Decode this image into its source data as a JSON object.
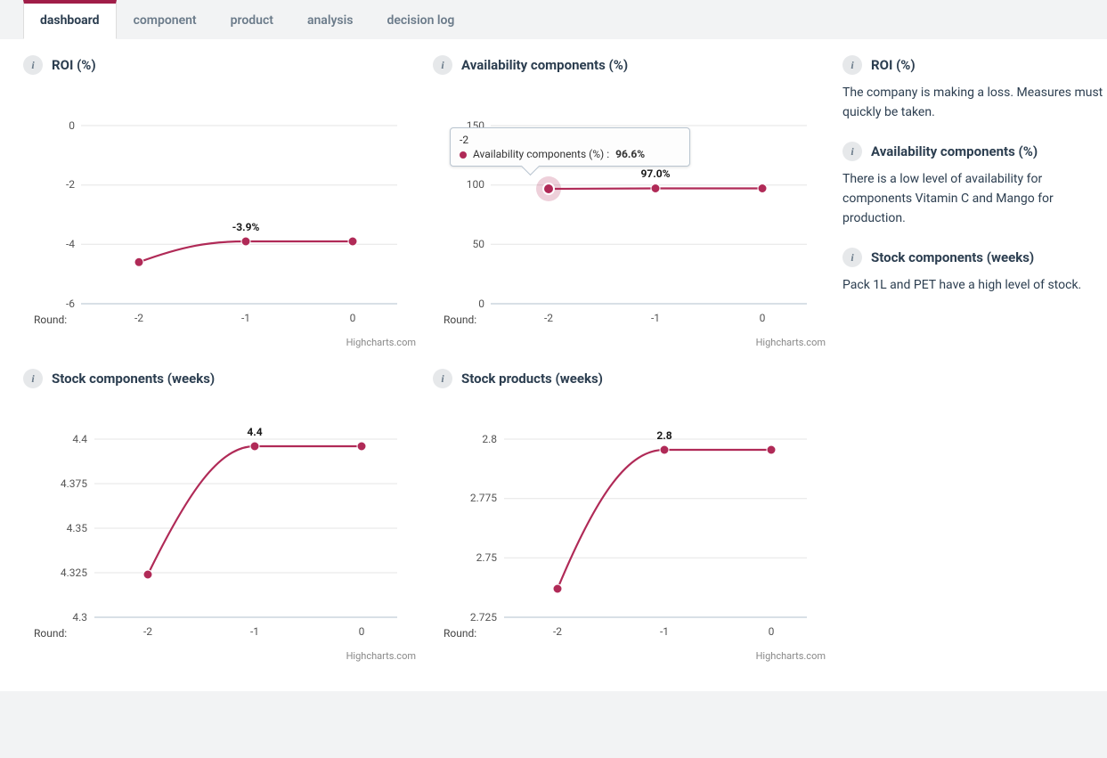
{
  "tabs": {
    "dashboard": "dashboard",
    "component": "component",
    "product": "product",
    "analysis": "analysis",
    "decision_log": "decision log"
  },
  "charts": {
    "roi": {
      "title": "ROI (%)",
      "xtitle": "Round:",
      "credit": "Highcharts.com",
      "ticks_y": [
        "0",
        "-2",
        "-4",
        "-6"
      ],
      "ticks_x": [
        "-2",
        "-1",
        "0"
      ],
      "datalabel": "-3.9%"
    },
    "availability": {
      "title": "Availability components (%)",
      "xtitle": "Round:",
      "credit": "Highcharts.com",
      "ticks_y": [
        "150",
        "100",
        "50",
        "0"
      ],
      "ticks_x": [
        "-2",
        "-1",
        "0"
      ],
      "datalabel": "97.0%",
      "tooltip_header": "-2",
      "tooltip_series": "Availability components (%) :",
      "tooltip_value": "96.6%"
    },
    "stock_components": {
      "title": "Stock components (weeks)",
      "xtitle": "Round:",
      "credit": "Highcharts.com",
      "ticks_y": [
        "4.4",
        "4.375",
        "4.35",
        "4.325",
        "4.3"
      ],
      "ticks_x": [
        "-2",
        "-1",
        "0"
      ],
      "datalabel": "4.4"
    },
    "stock_products": {
      "title": "Stock products (weeks)",
      "xtitle": "Round:",
      "credit": "Highcharts.com",
      "ticks_y": [
        "2.8",
        "2.775",
        "2.75",
        "2.725"
      ],
      "ticks_x": [
        "-2",
        "-1",
        "0"
      ],
      "datalabel": "2.8"
    }
  },
  "sidebar": {
    "roi": {
      "title": "ROI (%)",
      "text": "The company is making a loss. Measures must quickly be taken."
    },
    "availability": {
      "title": "Availability components (%)",
      "text": "There is a low level of availability for components Vitamin C and Mango for production."
    },
    "stock": {
      "title": "Stock components (weeks)",
      "text": "Pack 1L and PET have a high level of stock."
    }
  },
  "colors": {
    "series": "#b02a57",
    "grid": "#e5e5e5",
    "axis": "#ccd6dd"
  },
  "chart_data": [
    {
      "type": "line",
      "title": "ROI (%)",
      "xlabel": "Round:",
      "ylabel": "",
      "categories": [
        "-2",
        "-1",
        "0"
      ],
      "values": [
        -4.6,
        -3.9,
        -3.9
      ],
      "ylim": [
        -6,
        0
      ],
      "data_label": "-3.9%"
    },
    {
      "type": "line",
      "title": "Availability components (%)",
      "xlabel": "Round:",
      "ylabel": "",
      "categories": [
        "-2",
        "-1",
        "0"
      ],
      "values": [
        96.6,
        97.0,
        97.0
      ],
      "ylim": [
        0,
        150
      ],
      "data_label": "97.0%",
      "highlighted_point": {
        "x": "-2",
        "value": 96.6
      }
    },
    {
      "type": "line",
      "title": "Stock components (weeks)",
      "xlabel": "Round:",
      "ylabel": "",
      "categories": [
        "-2",
        "-1",
        "0"
      ],
      "values": [
        4.324,
        4.4,
        4.4
      ],
      "ylim": [
        4.3,
        4.4
      ],
      "data_label": "4.4"
    },
    {
      "type": "line",
      "title": "Stock products (weeks)",
      "xlabel": "Round:",
      "ylabel": "",
      "categories": [
        "-2",
        "-1",
        "0"
      ],
      "values": [
        2.737,
        2.8,
        2.8
      ],
      "ylim": [
        2.725,
        2.8
      ],
      "data_label": "2.8"
    }
  ]
}
